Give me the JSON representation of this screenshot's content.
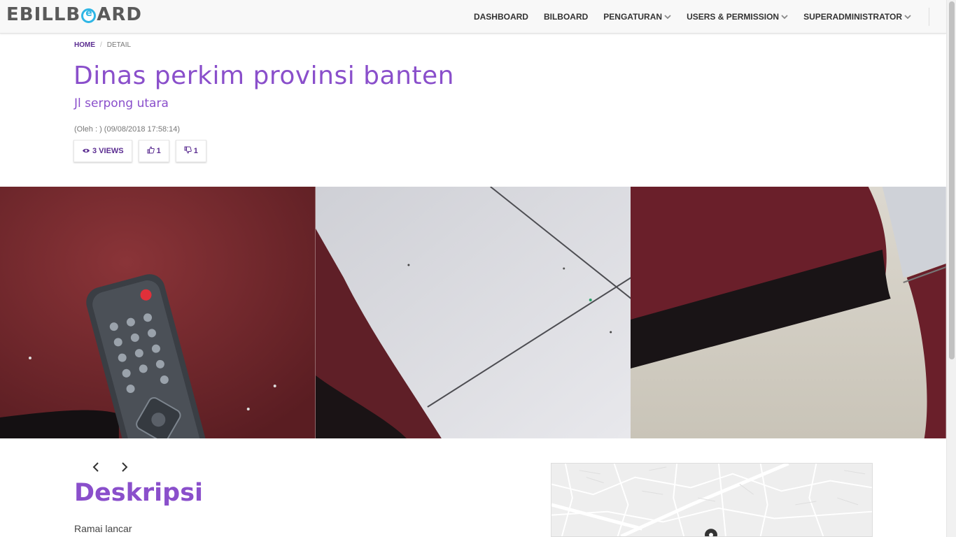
{
  "brand": {
    "text_left": "EBILLB",
    "text_right": "ARD",
    "accent": "#2fb6e5"
  },
  "nav": {
    "items": [
      {
        "label": "DASHBOARD",
        "has_dropdown": false
      },
      {
        "label": "BILBOARD",
        "has_dropdown": false
      },
      {
        "label": "PENGATURAN",
        "has_dropdown": true
      },
      {
        "label": "USERS & PERMISSION",
        "has_dropdown": true
      },
      {
        "label": "SUPERADMINISTRATOR",
        "has_dropdown": true
      }
    ],
    "dropdown_icon": "chevron-down-icon"
  },
  "breadcrumb": {
    "home": "HOME",
    "separator": "/",
    "current": "DETAIL"
  },
  "detail": {
    "title": "Dinas perkim provinsi banten",
    "subtitle": "Jl serpong utara",
    "meta": "(Oleh : ) (09/08/2018 17:58:14)"
  },
  "stats": {
    "views": "3 VIEWS",
    "likes": "1",
    "dislikes": "1",
    "views_icon": "eye-icon",
    "likes_icon": "thumbs-up-icon",
    "dislikes_icon": "thumbs-down-icon"
  },
  "gallery": {
    "photos": [
      {
        "alt": "remote-on-carpet-photo"
      },
      {
        "alt": "carpet-edge-on-tile-photo"
      },
      {
        "alt": "carpet-corner-photo"
      }
    ]
  },
  "carousel": {
    "prev_icon": "chevron-left-icon",
    "next_icon": "chevron-right-icon",
    "prev": "‹",
    "next": "›"
  },
  "description": {
    "heading": "Deskripsi",
    "text": "Ramai lancar"
  },
  "colors": {
    "primary": "#8a4fcb",
    "link": "#5b2d91",
    "navbar_bg": "#f8f8f8"
  }
}
